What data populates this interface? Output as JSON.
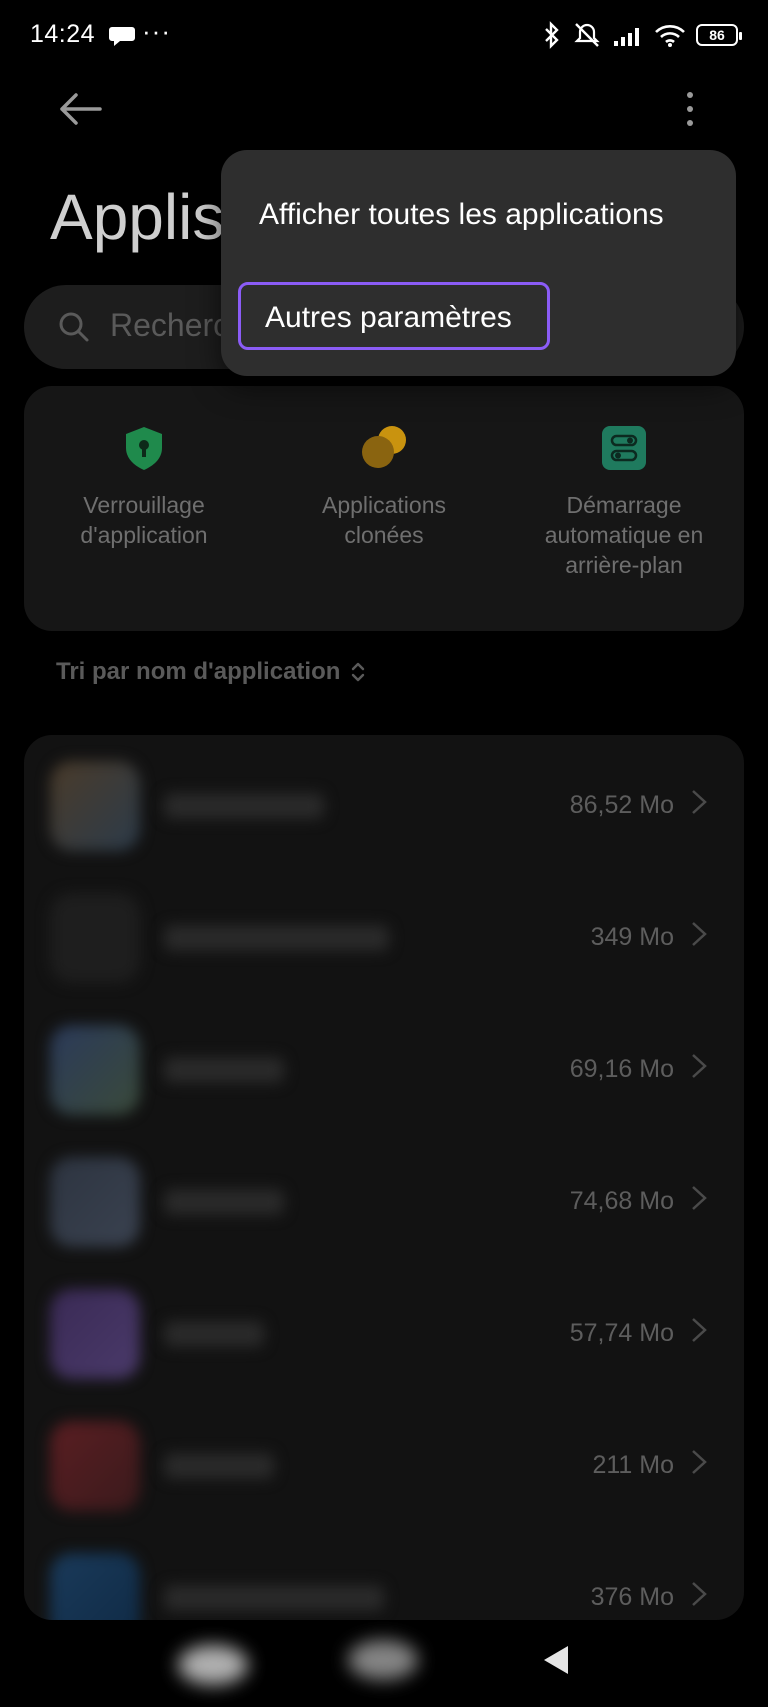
{
  "status_bar": {
    "time": "14:24",
    "overflow": "···",
    "battery": "86",
    "icons": [
      "chat-bubble-icon",
      "bluetooth-icon",
      "mute-icon",
      "signal-icon",
      "wifi-icon",
      "battery-icon"
    ]
  },
  "header": {
    "title": "Applis",
    "back_icon": "arrow-left-icon",
    "more_icon": "more-vertical-icon"
  },
  "search": {
    "placeholder": "Recherc"
  },
  "shortcuts": [
    {
      "label": "Verrouillage\nd'application",
      "icon": "shield-lock-icon",
      "color": "#1f8a4c"
    },
    {
      "label": "Applications\nclonées",
      "icon": "clone-circles-icon",
      "color": "#b8860b"
    },
    {
      "label": "Démarrage\nautomatique en\narrière-plan",
      "icon": "toggle-autostart-icon",
      "color": "#1f7a5e"
    }
  ],
  "sort": {
    "label": "Tri par nom d'application",
    "icon": "sort-updown-icon"
  },
  "apps": [
    {
      "size": "86,52 Mo"
    },
    {
      "size": "349 Mo"
    },
    {
      "size": "69,16 Mo"
    },
    {
      "size": "74,68 Mo"
    },
    {
      "size": "57,74 Mo"
    },
    {
      "size": "211 Mo"
    },
    {
      "size": "376 Mo"
    }
  ],
  "menu": {
    "items": [
      {
        "label": "Afficher toutes les applications"
      },
      {
        "label": "Autres paramètres",
        "highlighted": true
      }
    ],
    "highlight_color": "#8b5cf6"
  },
  "navbar": {
    "icons": [
      "home-icon",
      "recents-icon",
      "back-triangle-icon"
    ]
  }
}
